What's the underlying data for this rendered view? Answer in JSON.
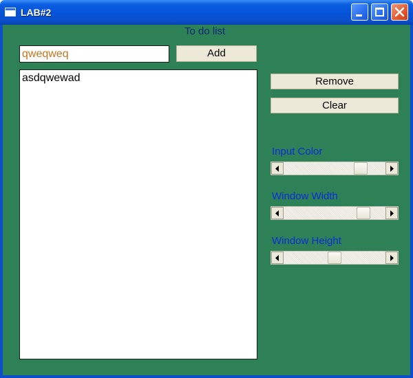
{
  "window": {
    "title": "LAB#2"
  },
  "main": {
    "heading": "To do list",
    "input": {
      "value": "qweqweq",
      "color": "#c8741c"
    },
    "add_label": "Add",
    "list_items": [
      "asdqwewad"
    ]
  },
  "controls": {
    "remove_label": "Remove",
    "clear_label": "Clear",
    "sliders": [
      {
        "label": "Input Color",
        "value": 0.8
      },
      {
        "label": "Window Width",
        "value": 0.83
      },
      {
        "label": "Window Height",
        "value": 0.5
      }
    ]
  },
  "colors": {
    "background": "#2e8157",
    "slider_label": "#0a2cd8",
    "title_bar": "#0552d8"
  }
}
